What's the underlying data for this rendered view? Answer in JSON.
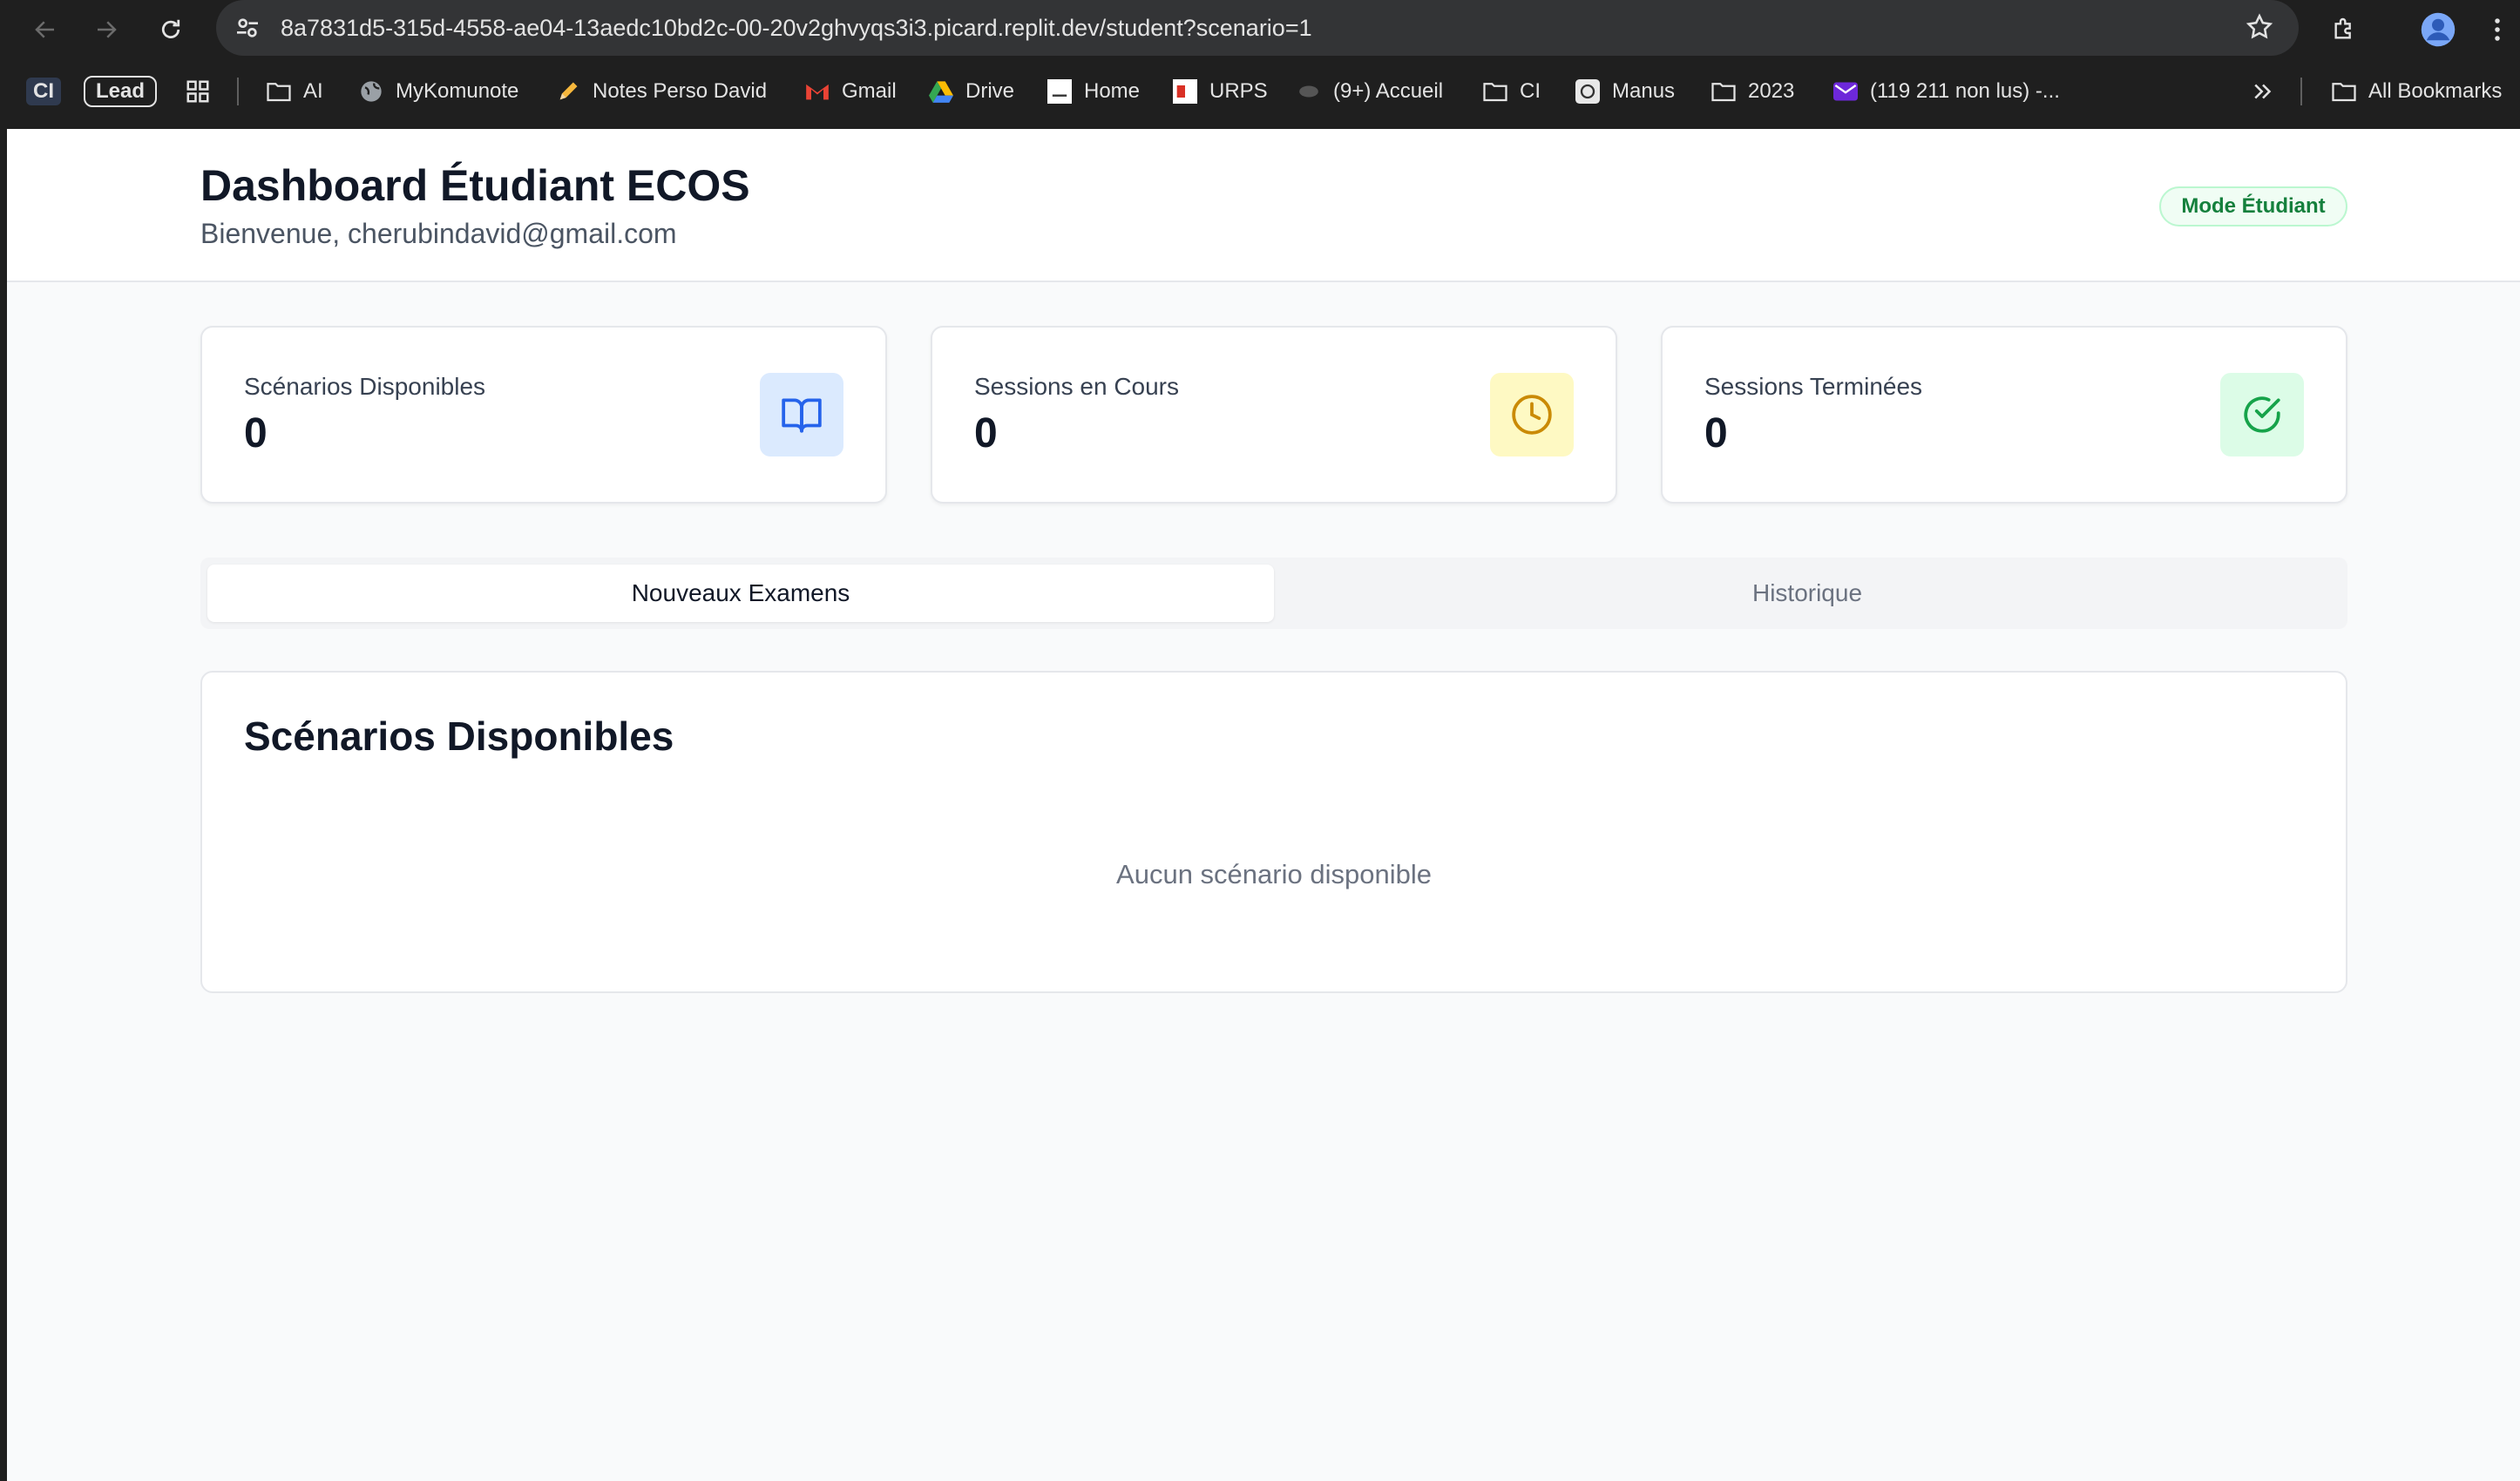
{
  "browser": {
    "url": "8a7831d5-315d-4558-ae04-13aedc10bd2c-00-20v2ghvyqs3i3.picard.replit.dev/student?scenario=1",
    "bookmarks": [
      "CI",
      "Lead",
      "AI",
      "MyKomunote",
      "Notes Perso David",
      "Gmail",
      "Drive",
      "Home",
      "URPS",
      "(9+) Accueil",
      "CI",
      "Manus",
      "2023",
      "(119 211 non lus) -...",
      "All Bookmarks"
    ]
  },
  "header": {
    "title": "Dashboard Étudiant ECOS",
    "welcome": "Bienvenue, cherubindavid@gmail.com",
    "mode_badge": "Mode Étudiant"
  },
  "stats": [
    {
      "label": "Scénarios Disponibles",
      "value": "0",
      "icon": "book-icon",
      "color": "#2563eb",
      "bg": "#dbeafe"
    },
    {
      "label": "Sessions en Cours",
      "value": "0",
      "icon": "clock-icon",
      "color": "#ca8a04",
      "bg": "#fef9c3"
    },
    {
      "label": "Sessions Terminées",
      "value": "0",
      "icon": "check-circle-icon",
      "color": "#16a34a",
      "bg": "#dcfce7"
    }
  ],
  "tabs": [
    {
      "label": "Nouveaux Examens",
      "active": true
    },
    {
      "label": "Historique",
      "active": false
    }
  ],
  "scenarios": {
    "title": "Scénarios Disponibles",
    "empty_message": "Aucun scénario disponible"
  }
}
